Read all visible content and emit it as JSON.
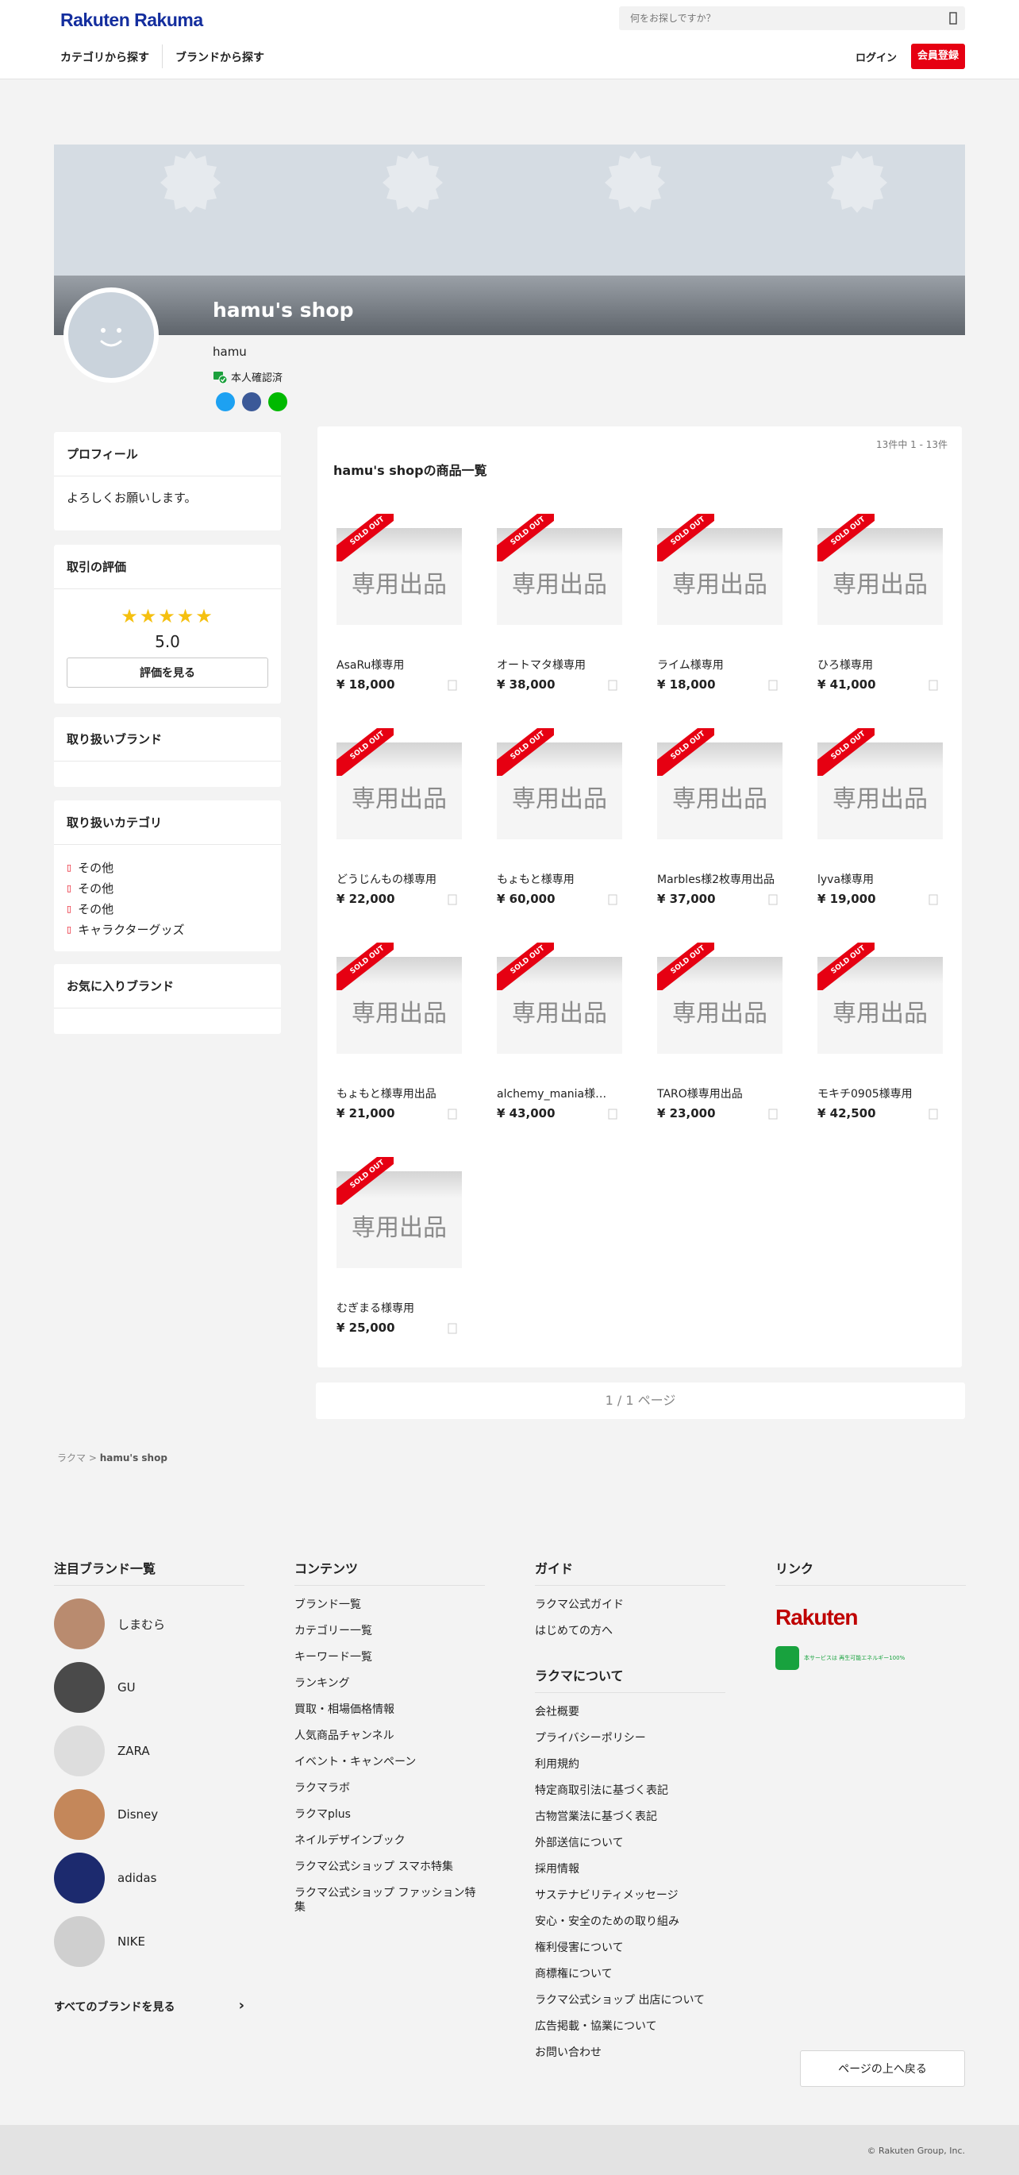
{
  "header": {
    "logo": "Rakuten Rakuma",
    "search_placeholder": "何をお探しですか？",
    "nav": [
      "カテゴリから探す",
      "ブランドから探す"
    ],
    "login": "ログイン",
    "signup": "会員登録"
  },
  "shop": {
    "title": "hamu's shop",
    "user": "hamu",
    "verified": "本人確認済"
  },
  "sidebar": {
    "profile_title": "プロフィール",
    "profile_text": "よろしくお願いします。",
    "review_title": "取引の評価",
    "stars": "★★★★★",
    "rating": "5.0",
    "review_button": "評価を見る",
    "brands_title": "取り扱いブランド",
    "categories_title": "取り扱いカテゴリ",
    "categories": [
      "その他",
      "その他",
      "その他",
      "キャラクターグッズ"
    ],
    "fav_brands_title": "お気に入りブランド"
  },
  "products": {
    "count": "13件中 1 - 13件",
    "title": "hamu's shopの商品一覧",
    "thumb_text": "専用出品",
    "sold_label": "SOLD OUT",
    "items": [
      {
        "name": "AsaRu様専用",
        "price": "¥ 18,000"
      },
      {
        "name": "オートマタ様専用",
        "price": "¥ 38,000"
      },
      {
        "name": "ライム様専用",
        "price": "¥ 18,000"
      },
      {
        "name": "ひろ様専用",
        "price": "¥ 41,000"
      },
      {
        "name": "どうじんもの様専用",
        "price": "¥ 22,000"
      },
      {
        "name": "もょもと様専用",
        "price": "¥ 60,000"
      },
      {
        "name": "Marbles様2枚専用出品",
        "price": "¥ 37,000"
      },
      {
        "name": "lyva様専用",
        "price": "¥ 19,000"
      },
      {
        "name": "もょもと様専用出品",
        "price": "¥ 21,000"
      },
      {
        "name": "alchemy_mania様専用",
        "price": "¥ 43,000"
      },
      {
        "name": "TARO様専用出品",
        "price": "¥ 23,000"
      },
      {
        "name": "モキチ0905様専用",
        "price": "¥ 42,500"
      },
      {
        "name": "むぎまる様専用",
        "price": "¥ 25,000"
      }
    ]
  },
  "pager": "1 / 1 ページ",
  "breadcrumb": [
    "ラクマ",
    "hamu's shop"
  ],
  "footer": {
    "brands_title": "注目ブランド一覧",
    "brands": [
      "しまむら",
      "GU",
      "ZARA",
      "Disney",
      "adidas",
      "NIKE"
    ],
    "all_brands": "すべてのブランドを見る",
    "contents_title": "コンテンツ",
    "contents": [
      "ブランド一覧",
      "カテゴリー一覧",
      "キーワード一覧",
      "ランキング",
      "買取・相場価格情報",
      "人気商品チャンネル",
      "イベント・キャンペーン",
      "ラクマラボ",
      "ラクマplus",
      "ネイルデザインブック",
      "ラクマ公式ショップ スマホ特集",
      "ラクマ公式ショップ ファッション特集"
    ],
    "guide_title": "ガイド",
    "guide": [
      "ラクマ公式ガイド",
      "はじめての方へ"
    ],
    "about_title": "ラクマについて",
    "about": [
      "会社概要",
      "プライバシーポリシー",
      "利用規約",
      "特定商取引法に基づく表記",
      "古物営業法に基づく表記",
      "外部送信について",
      "採用情報",
      "サステナビリティメッセージ",
      "安心・安全のための取り組み",
      "権利侵害について",
      "商標権について",
      "ラクマ公式ショップ 出店について",
      "広告掲載・協業について",
      "お問い合わせ"
    ],
    "links_title": "リンク",
    "rakuten_logo": "Rakuten",
    "green_text": "本サービスは 再生可能エネルギー100%",
    "back_top": "ページの上へ戻る",
    "copyright": "© Rakuten Group, Inc."
  },
  "colors": {
    "accent": "#e60012",
    "logo": "#142e9e",
    "star": "#f5c010"
  }
}
